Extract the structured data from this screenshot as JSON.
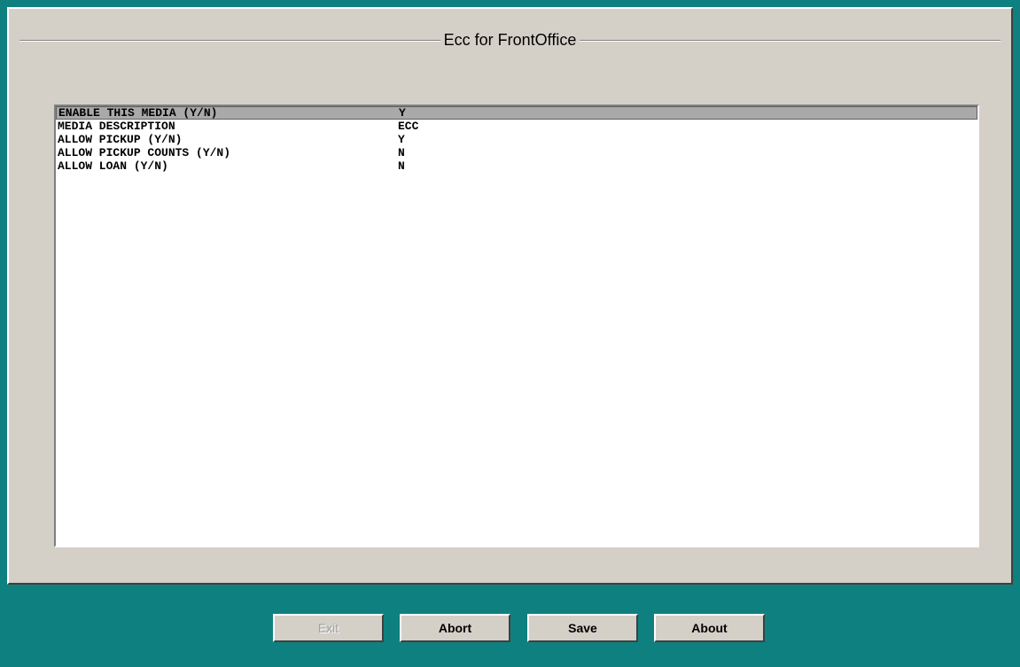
{
  "window": {
    "title": "Ecc for FrontOffice"
  },
  "rows": [
    {
      "label": "ENABLE THIS MEDIA (Y/N)",
      "value": "Y",
      "selected": true
    },
    {
      "label": "MEDIA DESCRIPTION",
      "value": "ECC",
      "selected": false
    },
    {
      "label": "ALLOW PICKUP (Y/N)",
      "value": "Y",
      "selected": false
    },
    {
      "label": "ALLOW PICKUP COUNTS (Y/N)",
      "value": "N",
      "selected": false
    },
    {
      "label": "ALLOW LOAN (Y/N)",
      "value": "N",
      "selected": false
    }
  ],
  "buttons": {
    "exit": "Exit",
    "abort": "Abort",
    "save": "Save",
    "about": "About"
  },
  "colors": {
    "background": "#0f8080",
    "panel": "#d4d0c8",
    "selection": "#a9a9a9"
  }
}
